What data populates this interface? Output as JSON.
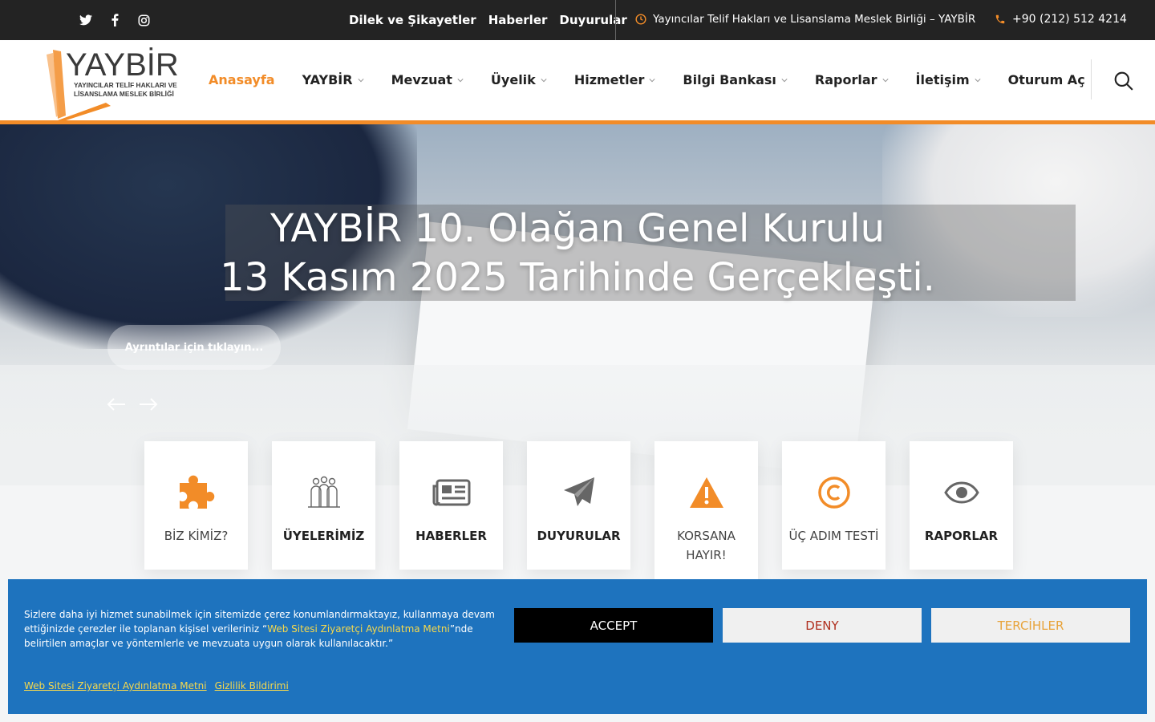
{
  "topbar": {
    "social": [
      "twitter-icon",
      "facebook-icon",
      "instagram-icon"
    ],
    "links": [
      "Dilek ve Şikayetler",
      "Haberler",
      "Duyurular"
    ],
    "org_name": "Yayıncılar Telif Hakları ve Lisanslama Meslek Birliği – YAYBİR",
    "phone": "+90 (212) 512 4214"
  },
  "logo": {
    "name": "YAYBİR",
    "line1": "YAYINCILAR TELİF HAKLARI VE",
    "line2": "LİSANSLAMA MESLEK BİRLİĞİ"
  },
  "nav": {
    "items": [
      {
        "label": "Anasayfa",
        "active": true,
        "dropdown": false
      },
      {
        "label": "YAYBİR",
        "active": false,
        "dropdown": true
      },
      {
        "label": "Mevzuat",
        "active": false,
        "dropdown": true
      },
      {
        "label": "Üyelik",
        "active": false,
        "dropdown": true
      },
      {
        "label": "Hizmetler",
        "active": false,
        "dropdown": true
      },
      {
        "label": "Bilgi Bankası",
        "active": false,
        "dropdown": true
      },
      {
        "label": "Raporlar",
        "active": false,
        "dropdown": true
      },
      {
        "label": "İletişim",
        "active": false,
        "dropdown": true
      },
      {
        "label": "Oturum Aç",
        "active": false,
        "dropdown": false
      }
    ]
  },
  "hero": {
    "title_line1": "YAYBİR 10. Olağan Genel Kurulu",
    "title_line2": "13 Kasım 2025 Tarihinde Gerçekleşti.",
    "button": "Ayrıntılar için tıklayın..."
  },
  "features": [
    {
      "label": "BİZ KİMİZ?",
      "icon": "puzzle-icon"
    },
    {
      "label": "ÜYELERİMİZ",
      "icon": "people-icon"
    },
    {
      "label": "HABERLER",
      "icon": "newspaper-icon"
    },
    {
      "label": "DUYURULAR",
      "icon": "paper-plane-icon"
    },
    {
      "label": "KORSANA HAYIR!",
      "icon": "warning-icon"
    },
    {
      "label": "ÜÇ ADIM TESTİ",
      "icon": "copyright-icon"
    },
    {
      "label": "RAPORLAR",
      "icon": "eye-icon"
    }
  ],
  "cookie": {
    "text_before": "Sizlere daha iyi hizmet sunabilmek için sitemizde çerez konumlandırmaktayız, kullanmaya devam ettiğinizde çerezler ile toplanan kişisel verileriniz “",
    "text_link": "Web Sitesi Ziyaretçi Aydınlatma Metni",
    "text_after": "”nde belirtilen amaçlar ve yöntemlerle ve mevzuata uygun olarak kullanılacaktır.”",
    "accept": "ACCEPT",
    "deny": "DENY",
    "preferences": "TERCİHLER",
    "link1": "Web Sitesi Ziyaretçi Aydınlatma Metni",
    "link2": "Gizlilik Bildirimi"
  },
  "colors": {
    "accent": "#f28c28",
    "topbar": "#232323",
    "cookie_bg": "#1e73be",
    "cookie_link": "#f7d94c"
  }
}
